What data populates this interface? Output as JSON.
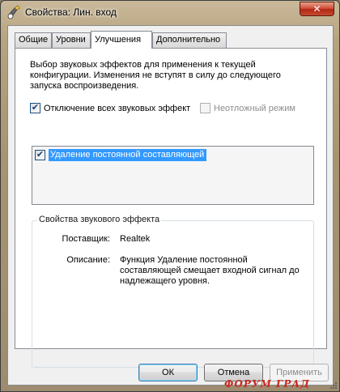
{
  "window": {
    "title": "Свойства: Лин. вход",
    "close_label": "✕"
  },
  "tabs": [
    {
      "label": "Общие"
    },
    {
      "label": "Уровни"
    },
    {
      "label": "Улучшения",
      "active": true
    },
    {
      "label": "Дополнительно"
    }
  ],
  "enhancements": {
    "description": "Выбор звуковых эффектов для применения к текущей конфигурации. Изменения не вступят в силу до следующего запуска воспроизведения.",
    "disable_all": {
      "label": "Отключение всех звуковых эффект",
      "checked": true
    },
    "immediate_mode": {
      "label": "Неотложный режим",
      "checked": false,
      "disabled": true
    },
    "list": [
      {
        "label": "Удаление постоянной составляющей",
        "checked": true,
        "selected": true
      }
    ]
  },
  "properties": {
    "group_title": "Свойства звукового эффекта",
    "provider_label": "Поставщик:",
    "provider_value": "Realtek",
    "description_label": "Описание:",
    "description_value": "Функция Удаление постоянной составляющей смещает входной сигнал до надлежащего уровня."
  },
  "buttons": {
    "ok": "ОК",
    "cancel": "Отмена",
    "apply": "Применить"
  },
  "watermark": "ФОРУМ ГРАД",
  "colors": {
    "selection": "#3399ff",
    "close_button": "#c8391f",
    "watermark": "#c8281e"
  },
  "icons": [
    "speaker-app-icon",
    "close-icon",
    "checkbox-checked-icon",
    "size-grip-icon"
  ]
}
